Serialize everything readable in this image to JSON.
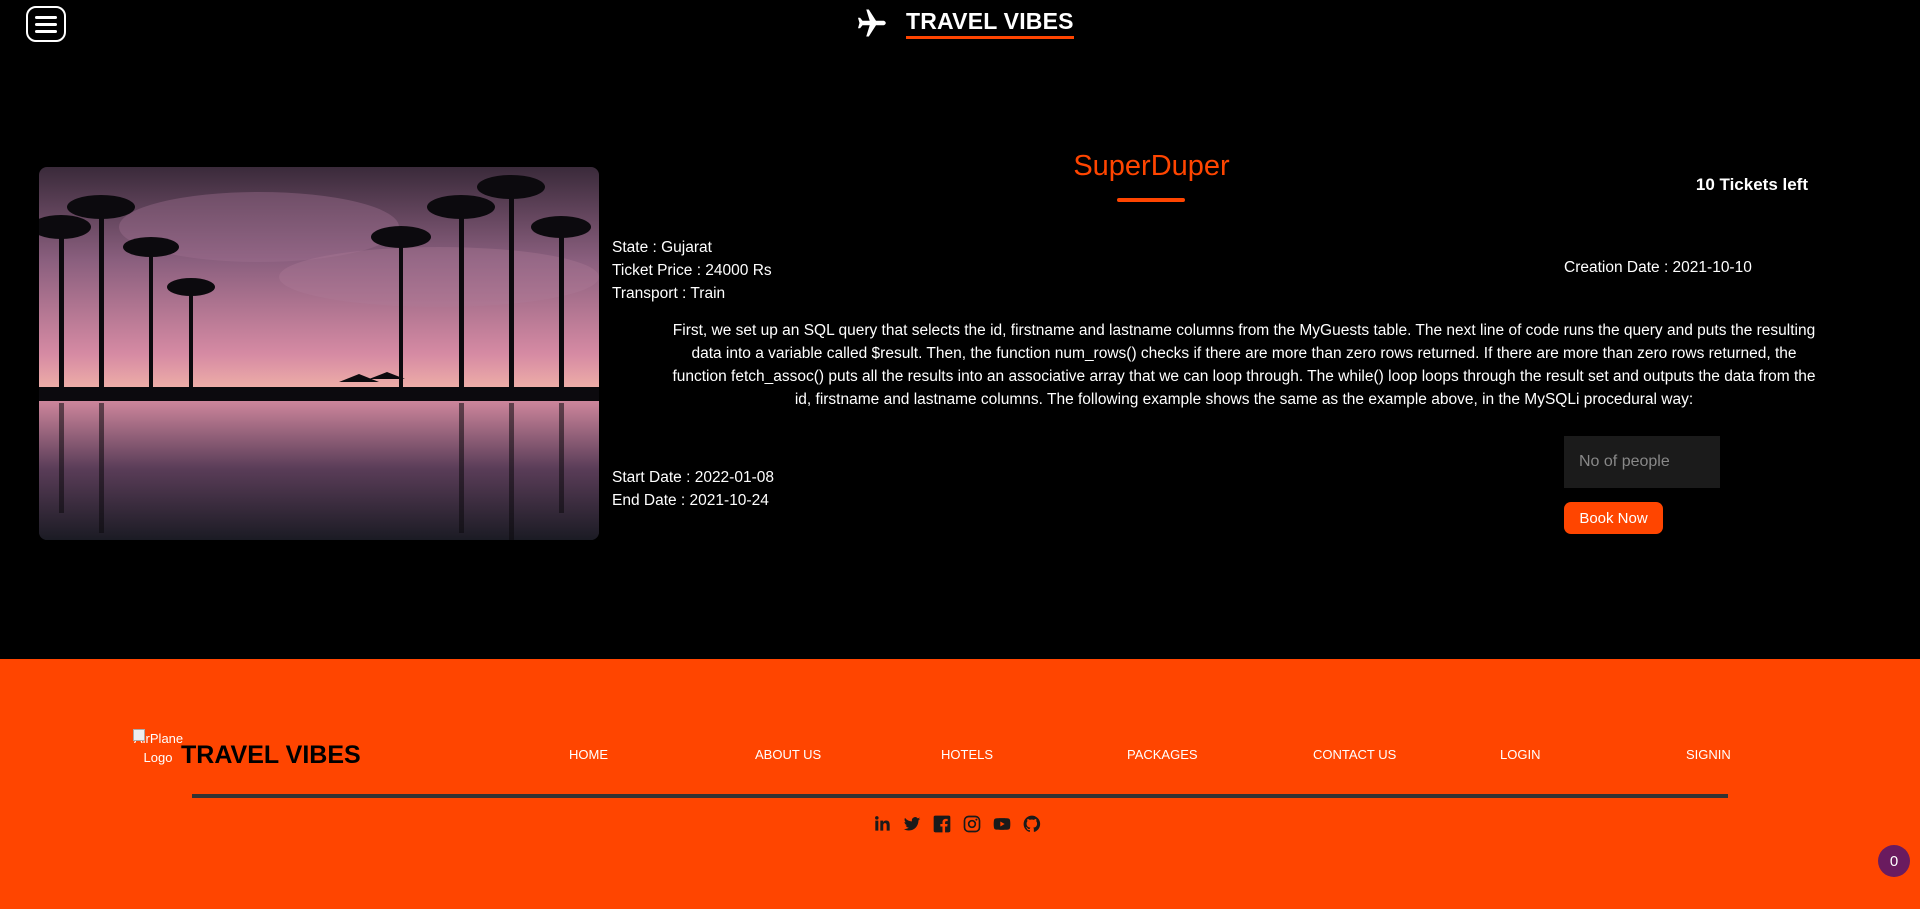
{
  "header": {
    "brand": "TRAVEL VIBES"
  },
  "package": {
    "title": "SuperDuper",
    "tickets_left": "10 Tickets left",
    "state": "State : Gujarat",
    "price": "Ticket Price : 24000 Rs",
    "transport": "Transport : Train",
    "creation_date": "Creation Date : 2021-10-10",
    "description": "First, we set up an SQL query that selects the id, firstname and lastname columns from the MyGuests table. The next line of code runs the query and puts the resulting data into a variable called $result. Then, the function num_rows() checks if there are more than zero rows returned. If there are more than zero rows returned, the function fetch_assoc() puts all the results into an associative array that we can loop through. The while() loop loops through the result set and outputs the data from the id, firstname and lastname columns. The following example shows the same as the example above, in the MySQLi procedural way:",
    "start_date": "Start Date : 2022-01-08",
    "end_date": "End Date : 2021-10-24",
    "people_placeholder": "No of people",
    "book_label": "Book Now"
  },
  "footer": {
    "logo_alt": "AirPlane Logo",
    "brand": "TRAVEL VIBES",
    "nav": {
      "home": "HOME",
      "about": "ABOUT US",
      "hotels": "HOTELS",
      "packages": "PACKAGES",
      "contact": "CONTACT US",
      "login": "LOGIN",
      "signin": "SIGNIN"
    },
    "social": [
      "linkedin-icon",
      "twitter-icon",
      "facebook-icon",
      "instagram-icon",
      "youtube-icon",
      "github-icon"
    ]
  },
  "badge_count": "0",
  "colors": {
    "accent": "#ff4500",
    "background": "#000000",
    "badge": "#6a1b5f"
  }
}
